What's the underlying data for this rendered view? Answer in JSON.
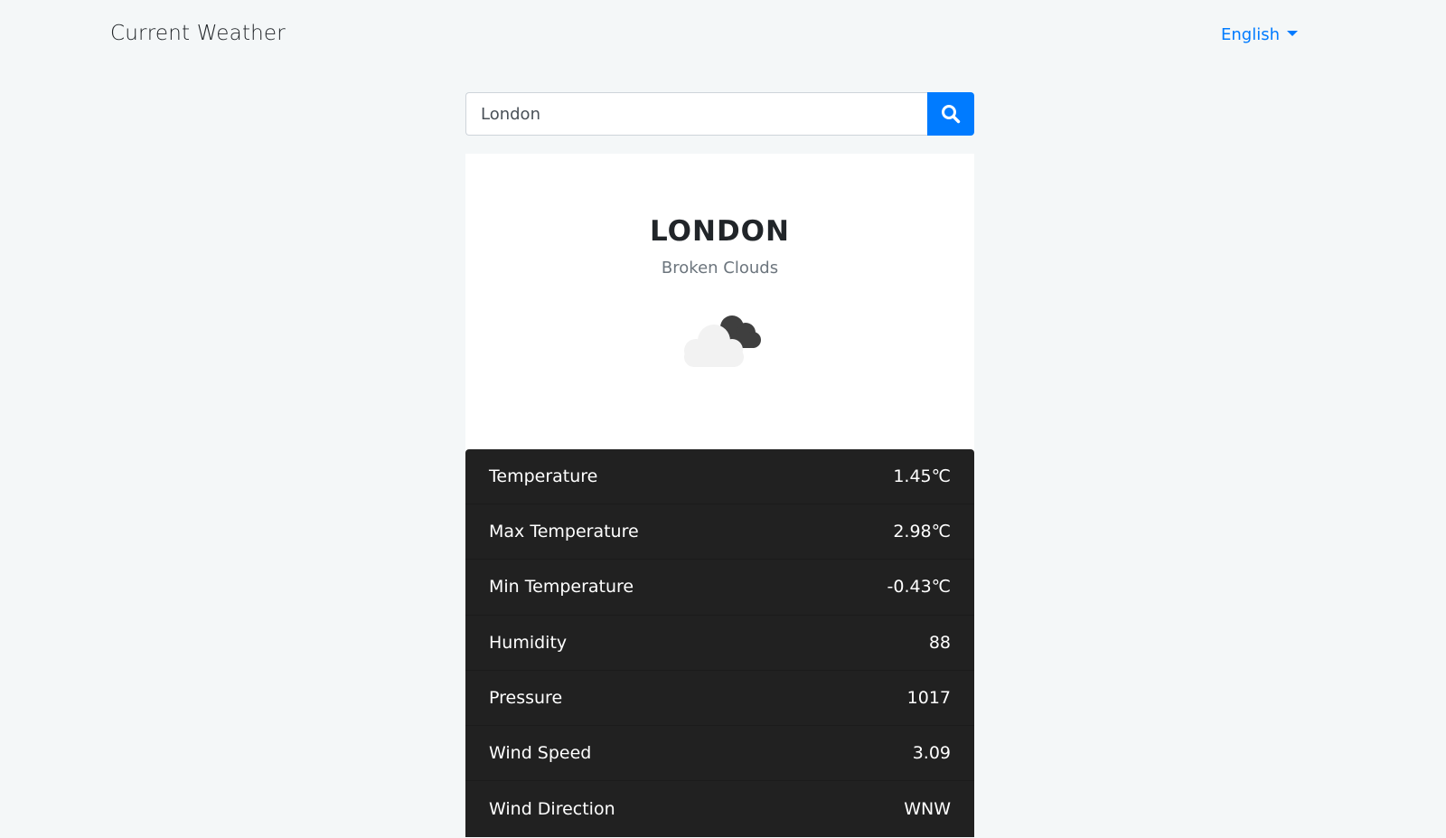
{
  "header": {
    "title": "Current Weather",
    "language": "English"
  },
  "search": {
    "value": "London",
    "button_icon": "search-icon"
  },
  "weather": {
    "city": "LONDON",
    "description": "Broken Clouds",
    "icon": "broken-clouds-icon"
  },
  "details": [
    {
      "label": "Temperature",
      "value": "1.45℃"
    },
    {
      "label": "Max Temperature",
      "value": "2.98℃"
    },
    {
      "label": "Min Temperature",
      "value": "-0.43℃"
    },
    {
      "label": "Humidity",
      "value": "88"
    },
    {
      "label": "Pressure",
      "value": "1017"
    },
    {
      "label": "Wind Speed",
      "value": "3.09"
    },
    {
      "label": "Wind Direction",
      "value": "WNW"
    }
  ],
  "colors": {
    "accent": "#007bff",
    "details_bg": "#212121",
    "page_bg": "#f4f7f8"
  }
}
